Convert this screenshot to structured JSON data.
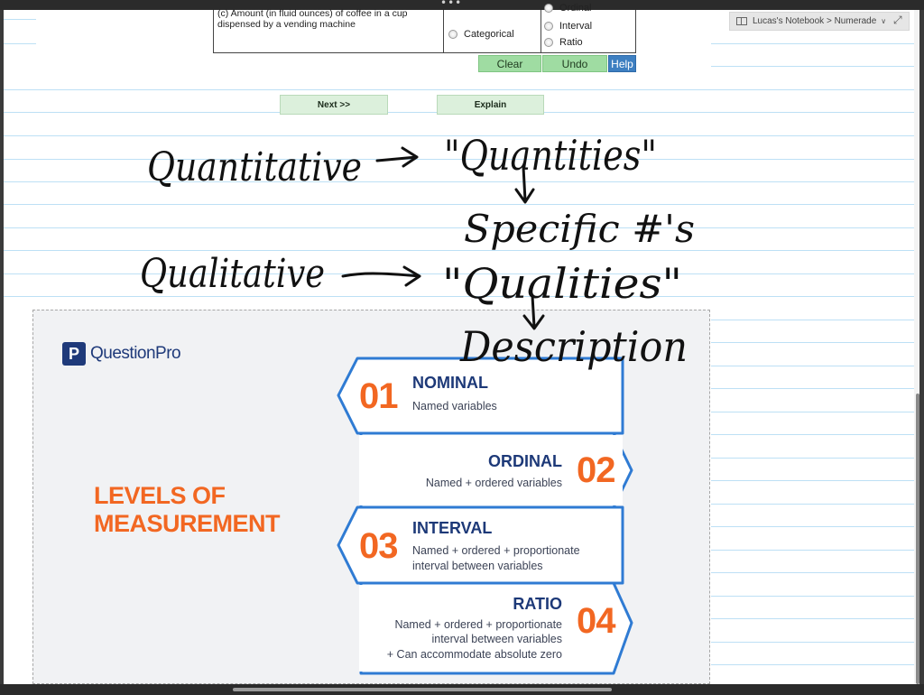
{
  "breadcrumb": {
    "label": "Lucas's Notebook > Numerade"
  },
  "question": {
    "item_text": "(c) Amount (in fluid ounces) of coffee in a cup dispensed by a vending machine",
    "category_option": "Categorical",
    "level_options": [
      "Ordinal",
      "Interval",
      "Ratio"
    ]
  },
  "buttons": {
    "clear": "Clear",
    "undo": "Undo",
    "help": "Help",
    "next": "Next >>",
    "explain": "Explain"
  },
  "handwriting": {
    "quantitative": "Quantitative",
    "quantities": "\"Quantities\"",
    "specific": "Specific #'s",
    "qualitative": "Qualitative",
    "qualities": "\"Qualities\"",
    "description": "Description"
  },
  "infographic": {
    "brand": "QuestionPro",
    "brand_mark": "P",
    "heading_line1": "LEVELS OF",
    "heading_line2": "MEASUREMENT",
    "accent_color": "#f26722",
    "navy_color": "#1d3978",
    "levels": [
      {
        "number": "01",
        "title": "NOMINAL",
        "desc": [
          "Named variables"
        ]
      },
      {
        "number": "02",
        "title": "ORDINAL",
        "desc": [
          "Named + ordered variables"
        ]
      },
      {
        "number": "03",
        "title": "INTERVAL",
        "desc": [
          "Named + ordered + proportionate",
          "interval between variables"
        ]
      },
      {
        "number": "04",
        "title": "RATIO",
        "desc": [
          "Named + ordered + proportionate",
          "interval between variables",
          "+ Can accommodate absolute zero"
        ]
      }
    ]
  }
}
